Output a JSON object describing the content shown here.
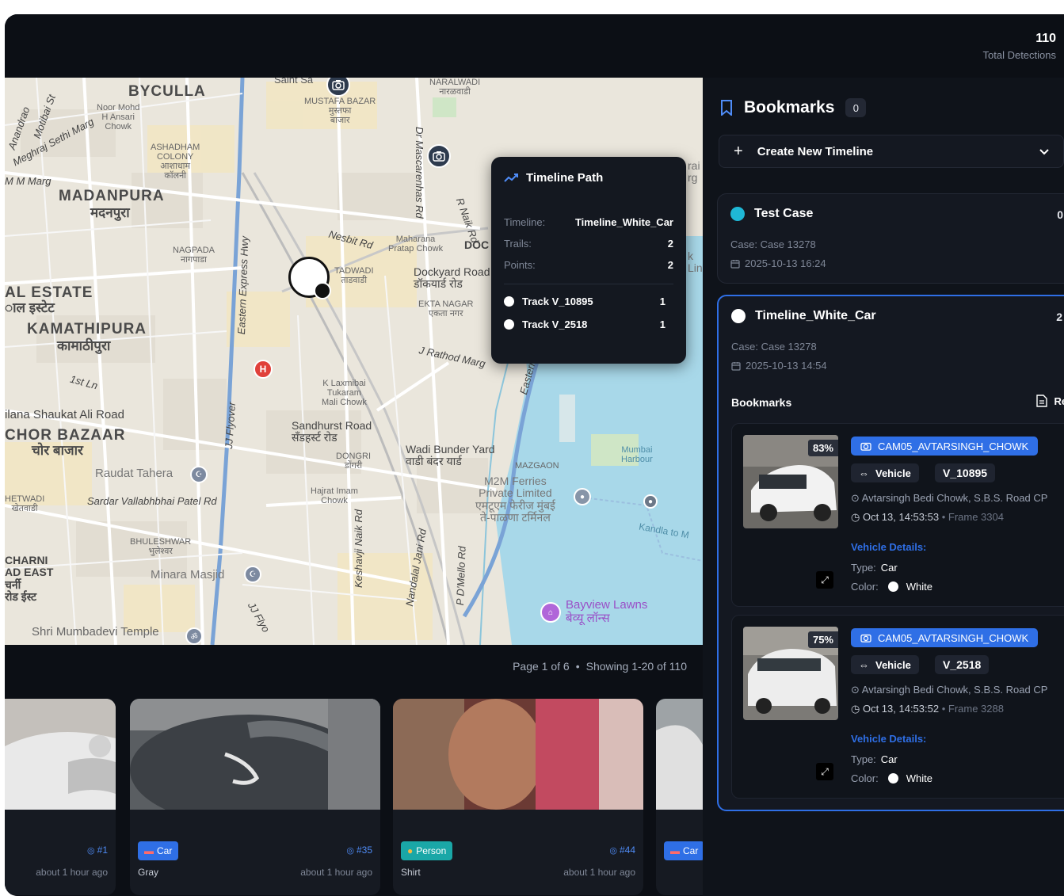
{
  "header": {
    "total_count": "110",
    "total_label": "Total Detections"
  },
  "map": {
    "labels": {
      "byculla": "BYCULLA",
      "noor_mohd": "Noor Mohd\nH Ansari\nChowk",
      "ashadham": "ASHADHAM\nCOLONY\nआशाधाम\nकॉलनी",
      "madanpura": "MADANPURA",
      "madanpura_d": "मदनपुरा",
      "nagpada": "NAGPADA\nनागपाडा",
      "al_estate": "AL ESTATE",
      "al_estate_d": "ाल इस्टेट",
      "kamathipura": "KAMATHIPURA",
      "kamathipura_d": "कामाठीपुरा",
      "first_ln": "1st Ln",
      "shaukat": "ilana Shaukat Ali Road",
      "chor_bazaar": "CHOR BAZAAR",
      "chor_bazaar_d": "चोर बाजार",
      "raudat": "Raudat Tahera",
      "hetwadi": "HETWADI\nखेतवाडी",
      "sardar": "Sardar Vallabhbhai Patel Rd",
      "bhuleshwar": "BHULESHWAR\nभुलेश्वर",
      "minara": "Minara Masjid",
      "charni": "CHARNI\nAD EAST\nचर्नी\nरोड ईस्ट",
      "shri_mumbadevi": "Shri Mumbadevi Temple",
      "mustafa": "MUSTAFA BAZAR\nमुस्तफा\nबाजार",
      "naralwadi": "NARALWADI\nनारळवाडी",
      "mascarenhas": "Dr Mascarenhas Rd",
      "nesbit": "Nesbit Rd",
      "maharana": "Maharana\nPratap Chowk",
      "tadwadi": "TADWADI\nताडवाडी",
      "dockyard": "Dockyard Road\nडॉकयार्ड रोड",
      "ekta_nagar": "EKTA NAGAR\nएकता नगर",
      "j_rathod": "J Rathod Marg",
      "k_laxmibai": "K Laxmibai\nTukaram\nMali Chowk",
      "sandhurst": "Sandhurst Road\nसँडहर्स्ट रोड",
      "dongri": "DONGRI\nडोंगरी",
      "wadi_bunder": "Wadi Bunder Yard\nवाडी बंदर यार्ड",
      "mazgaon": "MAZGAON",
      "m2m": "M2M Ferries\nPrivate Limited\nएमटूएम फेरीज मुंबई\nते-पाळणा टर्मिनल",
      "hajrat": "Hajrat Imam\nChowk",
      "keshavji": "Keshavji Naik Rd",
      "nandalal": "Nandalal Jani Rd",
      "pd_mello": "P D'Mello Rd",
      "eastern_fwy": "Eastern Fwy",
      "eastern_express": "Eastern Express Hwy",
      "jj_flyover": "JJ Flyover",
      "mumbai_harbour": "Mumbai\nHarbour",
      "kandla": "Kandla to M",
      "bayview": "Bayview Lawns\nबेव्यू लॉन्स",
      "doc": "DOC",
      "r_naik": "R Naik Rd",
      "saint": "Saint Sa",
      "anandrao": "Anandrao",
      "motibai": "Motibai St",
      "meghraj": "Meghraj Sethi Marg",
      "m_marg": "M M Marg",
      "jj_flyo2": "JJ Flyo",
      "rai_frag": "rai\nrg",
      "k_frag": "k\nLin"
    }
  },
  "timeline_popup": {
    "title": "Timeline Path",
    "timeline_label": "Timeline:",
    "timeline_value": "Timeline_White_Car",
    "trails_label": "Trails:",
    "trails_value": "2",
    "points_label": "Points:",
    "points_value": "2",
    "tracks": [
      {
        "name": "Track V_10895",
        "count": "1"
      },
      {
        "name": "Track V_2518",
        "count": "1"
      }
    ]
  },
  "pagination": {
    "page_text": "Page 1 of 6",
    "separator": "•",
    "showing_text": "Showing 1-20 of 110"
  },
  "detections": [
    {
      "badge": "",
      "track": "#1",
      "attr": "",
      "time": "about 1 hour ago"
    },
    {
      "badge": "Car",
      "track": "#35",
      "attr": "Gray",
      "time": "about 1 hour ago"
    },
    {
      "badge": "Person",
      "track": "#44",
      "attr": "Shirt",
      "time": "about 1 hour ago"
    },
    {
      "badge": "Car",
      "track": "",
      "attr": "",
      "time": ""
    }
  ],
  "sidebar": {
    "title": "Bookmarks",
    "count": "0",
    "create_label": "Create New Timeline",
    "cases": [
      {
        "name": "Test Case",
        "count": "0",
        "case_line": "Case: Case 13278",
        "date": "2025-10-13 16:24",
        "dot_color": "#1fb8d6"
      },
      {
        "name": "Timeline_White_Car",
        "count": "2",
        "case_line": "Case: Case 13278",
        "date": "2025-10-13 14:54",
        "dot_color": "#ffffff",
        "bookmarks_title": "Bookmarks",
        "report_label": "Rep",
        "bookmarks": [
          {
            "confidence": "83%",
            "camera": "CAM05_AVTARSINGH_CHOWK",
            "type_chip": "Vehicle",
            "track": "V_10895",
            "location": "Avtarsingh Bedi Chowk, S.B.S. Road CP",
            "time": "Oct 13, 14:53:53",
            "frame": "• Frame 3304",
            "details_title": "Vehicle Details:",
            "type_label": "Type:",
            "type_value": "Car",
            "color_label": "Color:",
            "color_value": "White"
          },
          {
            "confidence": "75%",
            "camera": "CAM05_AVTARSINGH_CHOWK",
            "type_chip": "Vehicle",
            "track": "V_2518",
            "location": "Avtarsingh Bedi Chowk, S.B.S. Road CP",
            "time": "Oct 13, 14:53:52",
            "frame": "• Frame 3288",
            "details_title": "Vehicle Details:",
            "type_label": "Type:",
            "type_value": "Car",
            "color_label": "Color:",
            "color_value": "White"
          }
        ]
      }
    ]
  },
  "colors": {
    "accent": "#2f6fe6",
    "background": "#0c0f15",
    "panel": "#141821",
    "person_badge": "#1aa7a7",
    "car_badge": "#2f6fe6"
  },
  "icons": [
    "camera-icon",
    "timeline-trend-icon",
    "bookmark-icon",
    "plus-icon",
    "chevron-down-icon",
    "calendar-icon",
    "report-icon",
    "car-icon",
    "person-icon",
    "pin-icon",
    "clock-icon",
    "expand-icon",
    "target-icon"
  ]
}
